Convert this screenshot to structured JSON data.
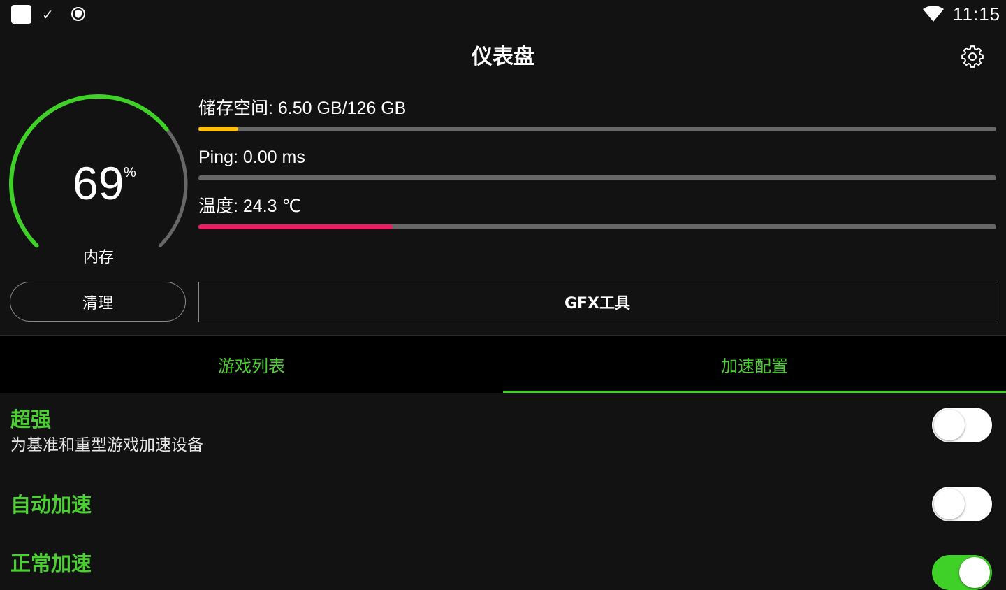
{
  "status_bar": {
    "time": "11:15",
    "icons": [
      "app-icon",
      "check-icon",
      "shield-icon",
      "wifi-icon"
    ]
  },
  "header": {
    "title": "仪表盘",
    "settings_icon": "gear-icon"
  },
  "memory_gauge": {
    "value": "69",
    "unit": "%",
    "label": "内存",
    "fraction": 0.69,
    "colors": {
      "filled": "#3fd127",
      "remaining": "#676767"
    }
  },
  "stats": [
    {
      "label": "储存空间: 6.50 GB/126 GB",
      "fraction": 0.05,
      "color": "#ffc107"
    },
    {
      "label": "Ping: 0.00 ms",
      "fraction": 0.0,
      "color": "#676767"
    },
    {
      "label": "温度: 24.3 ℃",
      "fraction": 0.243,
      "color": "#e91e63"
    }
  ],
  "actions": {
    "clean_label": "清理",
    "gfx_label": "GFX工具"
  },
  "tabs": [
    {
      "label": "游戏列表",
      "active": false
    },
    {
      "label": "加速配置",
      "active": true
    }
  ],
  "options": [
    {
      "title": "超强",
      "description": "为基准和重型游戏加速设备",
      "enabled": false
    },
    {
      "title": "自动加速",
      "description": "",
      "enabled": false
    },
    {
      "title": "正常加速",
      "description": "",
      "enabled": true
    }
  ],
  "colors": {
    "accent": "#3fd127",
    "background": "#121212",
    "tab_bar": "#000000"
  }
}
